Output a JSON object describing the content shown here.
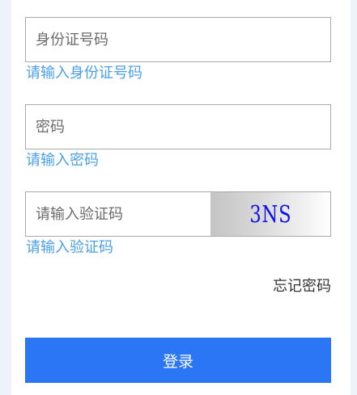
{
  "form": {
    "id_field": {
      "placeholder": "身份证号码",
      "hint": "请输入身份证号码"
    },
    "password_field": {
      "placeholder": "密码",
      "hint": "请输入密码"
    },
    "captcha_field": {
      "placeholder": "请输入验证码",
      "captcha_text": "3NS",
      "hint": "请输入验证码"
    },
    "forgot_label": "忘记密码",
    "login_label": "登录"
  },
  "colors": {
    "hint_text": "#4a9fe8",
    "login_button": "#2a76f5",
    "captcha_text": "#1010ee"
  }
}
